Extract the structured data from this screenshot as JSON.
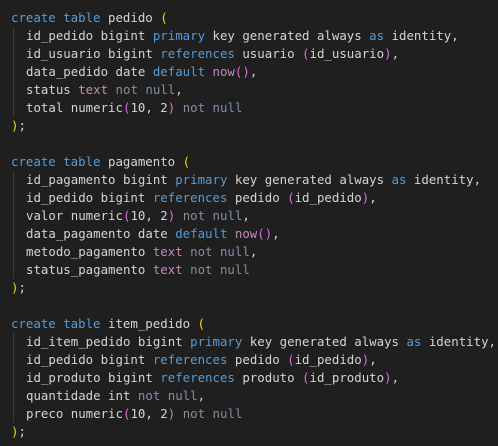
{
  "colors": {
    "background": "#1f1f1f",
    "plain": "#d4d4d4",
    "keyword": "#569cd6",
    "function": "#dcdcaa",
    "paren_gold": "#ffd700",
    "paren_purple": "#da70d6",
    "paren_blue": "#179fff",
    "number": "#b5cea8",
    "muted": "#7f8fa4",
    "magenta": "#c586c0"
  },
  "code_lines": [
    [
      {
        "t": "create table",
        "c": "keyword"
      },
      {
        "t": " pedido ",
        "c": "plain"
      },
      {
        "t": "(",
        "c": "paren_gold"
      }
    ],
    [
      {
        "t": "id_pedido bigint ",
        "c": "plain",
        "i": 1
      },
      {
        "t": "primary",
        "c": "keyword"
      },
      {
        "t": " key generated always ",
        "c": "plain"
      },
      {
        "t": "as",
        "c": "keyword"
      },
      {
        "t": " identity,",
        "c": "plain"
      }
    ],
    [
      {
        "t": "id_usuario bigint ",
        "c": "plain",
        "i": 1
      },
      {
        "t": "references",
        "c": "keyword"
      },
      {
        "t": " usuario ",
        "c": "plain"
      },
      {
        "t": "(",
        "c": "paren_purple"
      },
      {
        "t": "id_usuario",
        "c": "plain"
      },
      {
        "t": ")",
        "c": "paren_purple"
      },
      {
        "t": ",",
        "c": "plain"
      }
    ],
    [
      {
        "t": "data_pedido date ",
        "c": "plain",
        "i": 1
      },
      {
        "t": "default",
        "c": "keyword"
      },
      {
        "t": " ",
        "c": "plain"
      },
      {
        "t": "now",
        "c": "magenta"
      },
      {
        "t": "()",
        "c": "paren_purple"
      },
      {
        "t": ",",
        "c": "plain"
      }
    ],
    [
      {
        "t": "status ",
        "c": "plain",
        "i": 1
      },
      {
        "t": "text",
        "c": "magenta"
      },
      {
        "t": " not null",
        "c": "muted"
      },
      {
        "t": ",",
        "c": "plain"
      }
    ],
    [
      {
        "t": "total numeric",
        "c": "plain",
        "i": 1
      },
      {
        "t": "(",
        "c": "paren_purple"
      },
      {
        "t": "10",
        "c": "plain"
      },
      {
        "t": ", ",
        "c": "plain"
      },
      {
        "t": "2",
        "c": "plain"
      },
      {
        "t": ")",
        "c": "paren_purple"
      },
      {
        "t": " not null",
        "c": "muted"
      }
    ],
    [
      {
        "t": ")",
        "c": "paren_gold"
      },
      {
        "t": ";",
        "c": "plain"
      }
    ],
    [],
    [
      {
        "t": "create table",
        "c": "keyword"
      },
      {
        "t": " pagamento ",
        "c": "plain"
      },
      {
        "t": "(",
        "c": "paren_gold"
      }
    ],
    [
      {
        "t": "id_pagamento bigint ",
        "c": "plain",
        "i": 1
      },
      {
        "t": "primary",
        "c": "keyword"
      },
      {
        "t": " key generated always ",
        "c": "plain"
      },
      {
        "t": "as",
        "c": "keyword"
      },
      {
        "t": " identity,",
        "c": "plain"
      }
    ],
    [
      {
        "t": "id_pedido bigint ",
        "c": "plain",
        "i": 1
      },
      {
        "t": "references",
        "c": "keyword"
      },
      {
        "t": " pedido ",
        "c": "plain"
      },
      {
        "t": "(",
        "c": "paren_purple"
      },
      {
        "t": "id_pedido",
        "c": "plain"
      },
      {
        "t": ")",
        "c": "paren_purple"
      },
      {
        "t": ",",
        "c": "plain"
      }
    ],
    [
      {
        "t": "valor numeric",
        "c": "plain",
        "i": 1
      },
      {
        "t": "(",
        "c": "paren_purple"
      },
      {
        "t": "10",
        "c": "plain"
      },
      {
        "t": ", ",
        "c": "plain"
      },
      {
        "t": "2",
        "c": "plain"
      },
      {
        "t": ")",
        "c": "paren_purple"
      },
      {
        "t": " not null",
        "c": "muted"
      },
      {
        "t": ",",
        "c": "plain"
      }
    ],
    [
      {
        "t": "data_pagamento date ",
        "c": "plain",
        "i": 1
      },
      {
        "t": "default",
        "c": "keyword"
      },
      {
        "t": " ",
        "c": "plain"
      },
      {
        "t": "now",
        "c": "magenta"
      },
      {
        "t": "()",
        "c": "paren_purple"
      },
      {
        "t": ",",
        "c": "plain"
      }
    ],
    [
      {
        "t": "metodo_pagamento ",
        "c": "plain",
        "i": 1
      },
      {
        "t": "text",
        "c": "magenta"
      },
      {
        "t": " not null",
        "c": "muted"
      },
      {
        "t": ",",
        "c": "plain"
      }
    ],
    [
      {
        "t": "status_pagamento ",
        "c": "plain",
        "i": 1
      },
      {
        "t": "text",
        "c": "magenta"
      },
      {
        "t": " not null",
        "c": "muted"
      }
    ],
    [
      {
        "t": ")",
        "c": "paren_gold"
      },
      {
        "t": ";",
        "c": "plain"
      }
    ],
    [],
    [
      {
        "t": "create table",
        "c": "keyword"
      },
      {
        "t": " item_pedido ",
        "c": "plain"
      },
      {
        "t": "(",
        "c": "paren_gold"
      }
    ],
    [
      {
        "t": "id_item_pedido bigint ",
        "c": "plain",
        "i": 1
      },
      {
        "t": "primary",
        "c": "keyword"
      },
      {
        "t": " key generated always ",
        "c": "plain"
      },
      {
        "t": "as",
        "c": "keyword"
      },
      {
        "t": " identity,",
        "c": "plain"
      }
    ],
    [
      {
        "t": "id_pedido bigint ",
        "c": "plain",
        "i": 1
      },
      {
        "t": "references",
        "c": "keyword"
      },
      {
        "t": " pedido ",
        "c": "plain"
      },
      {
        "t": "(",
        "c": "paren_purple"
      },
      {
        "t": "id_pedido",
        "c": "plain"
      },
      {
        "t": ")",
        "c": "paren_purple"
      },
      {
        "t": ",",
        "c": "plain"
      }
    ],
    [
      {
        "t": "id_produto bigint ",
        "c": "plain",
        "i": 1
      },
      {
        "t": "references",
        "c": "keyword"
      },
      {
        "t": " produto ",
        "c": "plain"
      },
      {
        "t": "(",
        "c": "paren_purple"
      },
      {
        "t": "id_produto",
        "c": "plain"
      },
      {
        "t": ")",
        "c": "paren_purple"
      },
      {
        "t": ",",
        "c": "plain"
      }
    ],
    [
      {
        "t": "quantidade int ",
        "c": "plain",
        "i": 1
      },
      {
        "t": "not null",
        "c": "muted"
      },
      {
        "t": ",",
        "c": "plain"
      }
    ],
    [
      {
        "t": "preco numeric",
        "c": "plain",
        "i": 1
      },
      {
        "t": "(",
        "c": "paren_purple"
      },
      {
        "t": "10",
        "c": "plain"
      },
      {
        "t": ", ",
        "c": "plain"
      },
      {
        "t": "2",
        "c": "plain"
      },
      {
        "t": ")",
        "c": "paren_purple"
      },
      {
        "t": " not null",
        "c": "muted"
      }
    ],
    [
      {
        "t": ")",
        "c": "paren_gold"
      },
      {
        "t": ";",
        "c": "plain"
      }
    ]
  ]
}
